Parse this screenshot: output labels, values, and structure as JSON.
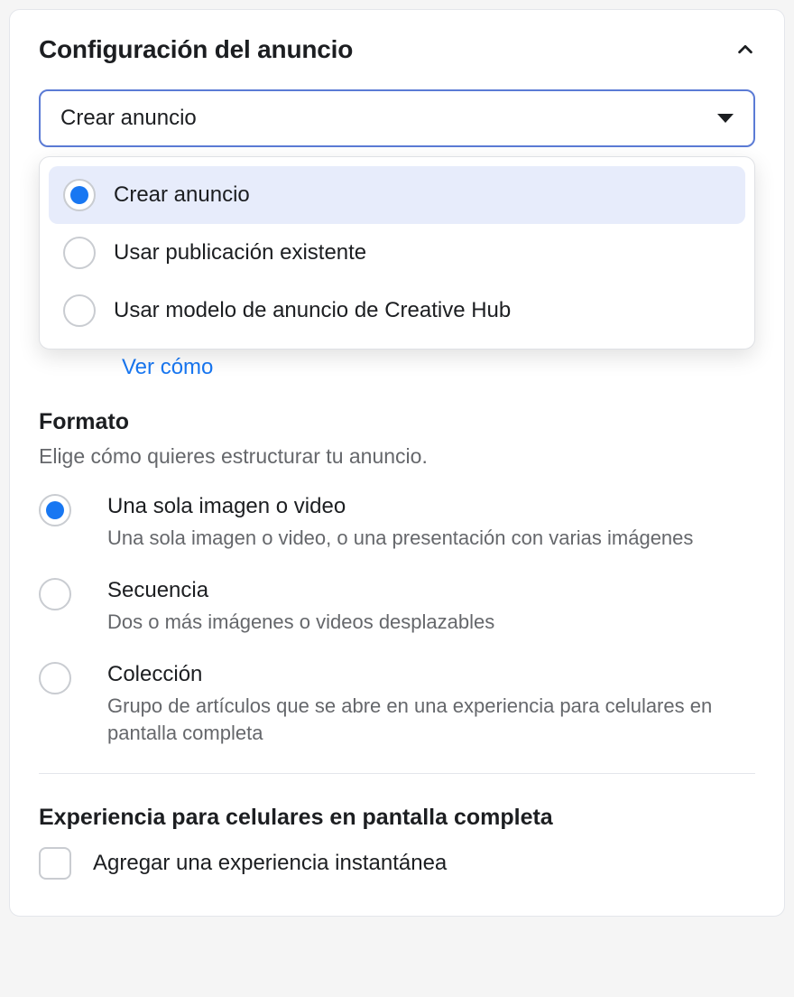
{
  "header": {
    "title": "Configuración del anuncio"
  },
  "select": {
    "current": "Crear anuncio",
    "options": [
      {
        "label": "Crear anuncio",
        "selected": true
      },
      {
        "label": "Usar publicación existente",
        "selected": false
      },
      {
        "label": "Usar modelo de anuncio de Creative Hub",
        "selected": false
      }
    ]
  },
  "link": {
    "label": "Ver cómo"
  },
  "format": {
    "title": "Formato",
    "description": "Elige cómo quieres estructurar tu anuncio.",
    "options": [
      {
        "label": "Una sola imagen o video",
        "sub": "Una sola imagen o video, o una presentación con varias imágenes",
        "selected": true
      },
      {
        "label": "Secuencia",
        "sub": "Dos o más imágenes o videos desplazables",
        "selected": false
      },
      {
        "label": "Colección",
        "sub": "Grupo de artículos que se abre en una experiencia para celulares en pantalla completa",
        "selected": false
      }
    ]
  },
  "experience": {
    "title": "Experiencia para celulares en pantalla completa",
    "checkbox_label": "Agregar una experiencia instantánea"
  }
}
